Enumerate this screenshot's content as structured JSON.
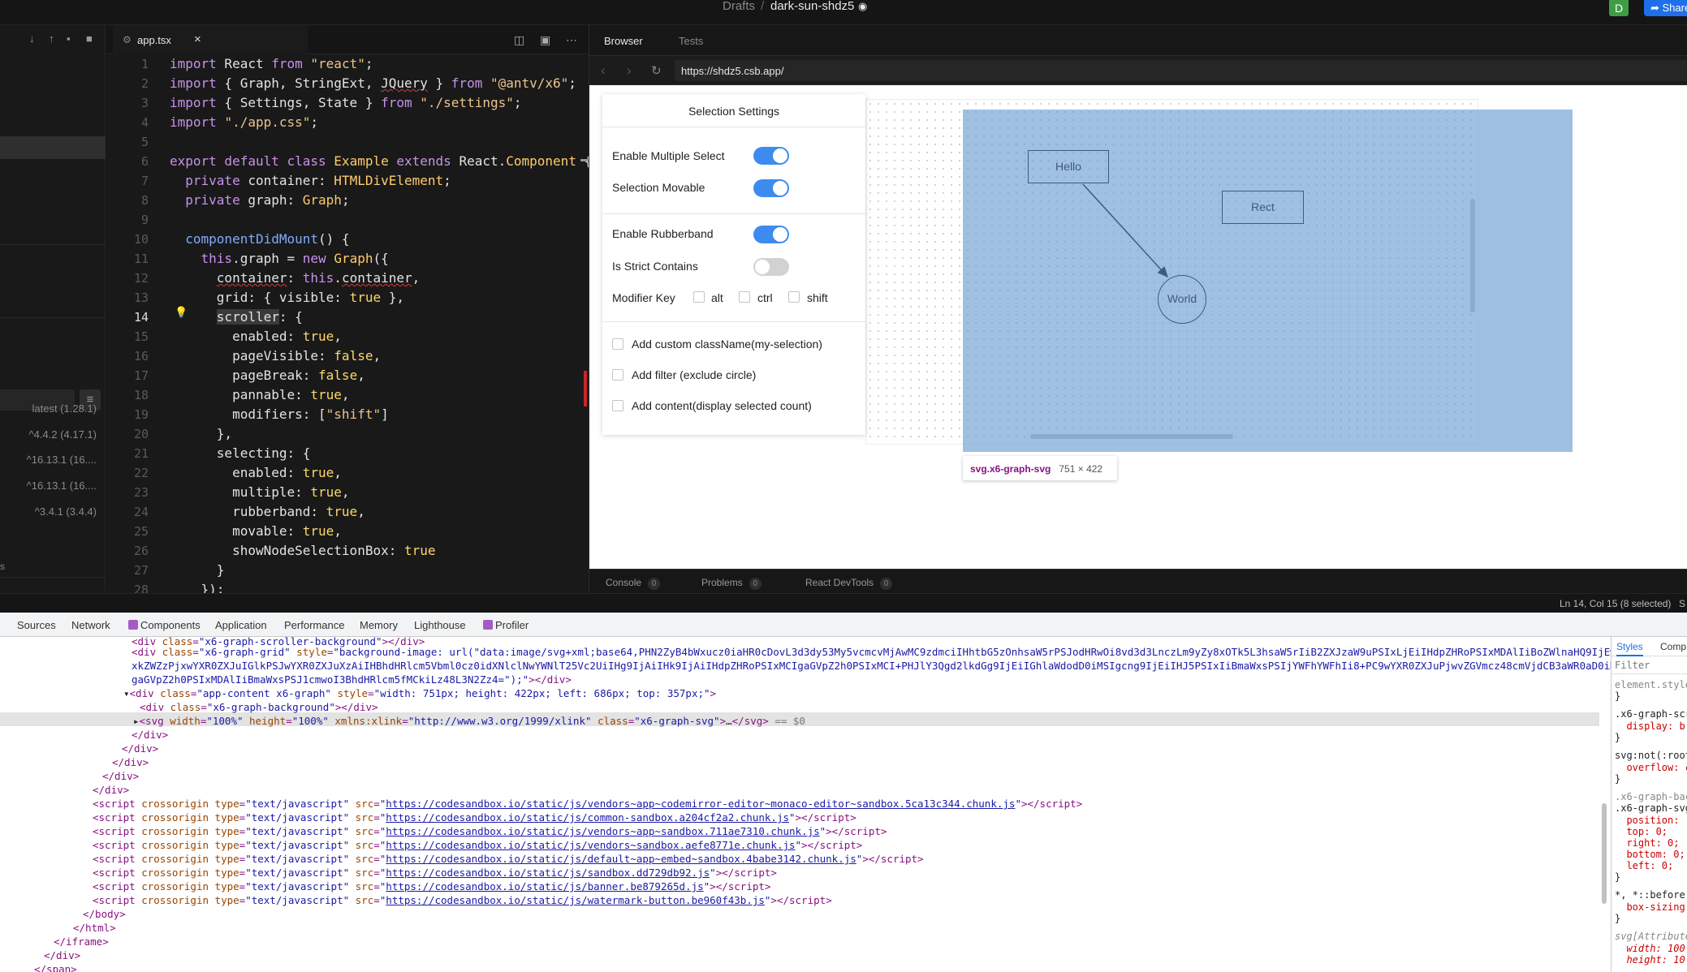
{
  "topbar": {
    "drafts": "Drafts",
    "sep": "/",
    "sandbox_name": "dark-sun-shdz5",
    "avatar": "D",
    "share": "Share"
  },
  "sidebar": {
    "deps": [
      "latest (1.28.1)",
      "^4.4.2 (4.17.1)",
      "^16.13.1 (16....",
      "^16.13.1 (16....",
      "^3.4.1 (3.4.4)"
    ],
    "cut_label": "s"
  },
  "editor": {
    "file_tab": "app.tsx",
    "close": "×",
    "current_line": 14
  },
  "browser": {
    "tabs": {
      "browser": "Browser",
      "tests": "Tests"
    },
    "url": "https://shdz5.csb.app/",
    "settings": {
      "title": "Selection Settings",
      "enable_multiple_select": "Enable Multiple Select",
      "selection_movable": "Selection Movable",
      "enable_rubberband": "Enable Rubberband",
      "is_strict_contains": "Is Strict Contains",
      "modifier_key": "Modifier Key",
      "mod_alt": "alt",
      "mod_ctrl": "ctrl",
      "mod_shift": "shift",
      "add_custom_class": "Add custom className(my-selection)",
      "add_filter": "Add filter (exclude circle)",
      "add_content": "Add content(display selected count)"
    },
    "toggles": {
      "multiple": true,
      "movable": true,
      "rubberband": true,
      "strict": false
    },
    "graph": {
      "node_hello": "Hello",
      "node_rect": "Rect",
      "node_world": "World"
    },
    "tooltip": {
      "tag": "svg.x6-graph-svg",
      "dims": "751 × 422"
    },
    "console_tabs": [
      {
        "label": "Console",
        "count": "0"
      },
      {
        "label": "Problems",
        "count": "0"
      },
      {
        "label": "React DevTools",
        "count": "0"
      }
    ]
  },
  "status": {
    "position": "Ln 14, Col 15 (8 selected)",
    "trail": "S"
  },
  "devtools": {
    "tabs": [
      "Sources",
      "Network",
      "Components",
      "Application",
      "Performance",
      "Memory",
      "Lighthouse",
      "Profiler"
    ],
    "styles_tabs": {
      "styles": "Styles",
      "computed": "Comp"
    },
    "filter": "Filter"
  }
}
